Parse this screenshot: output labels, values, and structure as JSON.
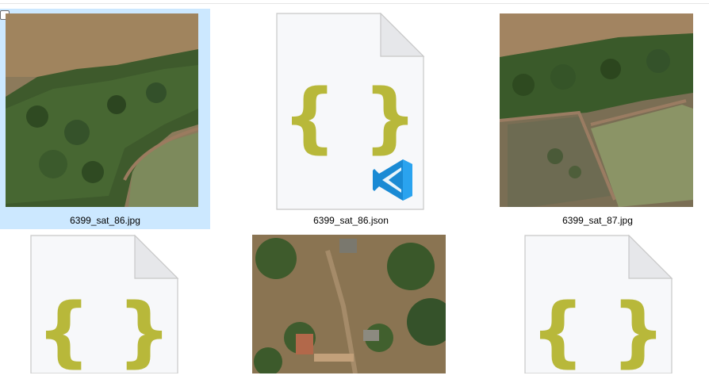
{
  "files": [
    {
      "name": "6399_sat_86.jpg",
      "type": "image",
      "selected": true
    },
    {
      "name": "6399_sat_86.json",
      "type": "json",
      "app_badge": "vscode-icon"
    },
    {
      "name": "6399_sat_87.jpg",
      "type": "image"
    },
    {
      "name": "",
      "type": "json"
    },
    {
      "name": "",
      "type": "image"
    },
    {
      "name": "",
      "type": "json"
    }
  ],
  "colors": {
    "selection": "#cce8ff",
    "braces": "#b8b83a",
    "vscode": "#1a8ad4"
  },
  "icons": {
    "json_glyph": "{ }"
  }
}
